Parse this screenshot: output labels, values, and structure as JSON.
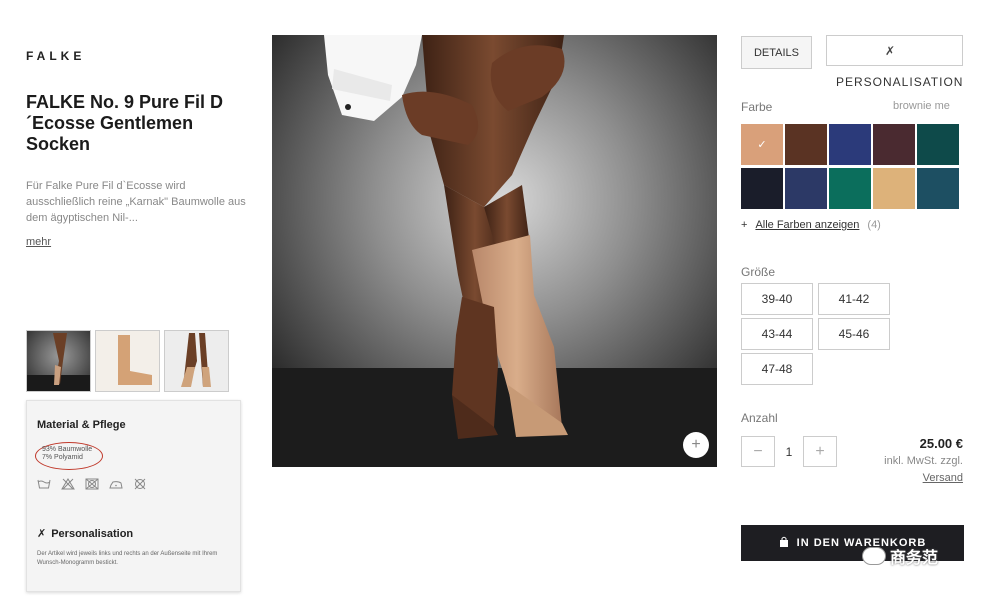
{
  "brand": "FALKE",
  "product": {
    "title": "FALKE No. 9 Pure Fil D ´Ecosse Gentlemen Socken",
    "description": "Für Falke Pure Fil d`Ecosse wird ausschließlich reine „Karnak\" Baumwolle aus dem ägyptischen Nil-...",
    "more_label": "mehr"
  },
  "care": {
    "title": "Material & Pflege",
    "material_lines": [
      "93% Baumwolle",
      "7% Polyamid"
    ],
    "icons": [
      "wash-30-icon",
      "no-bleach-icon",
      "no-tumble-dry-icon",
      "iron-icon",
      "no-dry-clean-icon"
    ],
    "personalisation_title": "Personalisation",
    "personalisation_text": "Der Artikel wird jeweils links und rechts an der Außenseite mit Ihrem Wunsch-Monogramm bestickt."
  },
  "tabs": {
    "details": "DETAILS",
    "personalisation": "PERSONALISATION",
    "personalisation_icon": "needle-icon"
  },
  "colors": {
    "label": "Farbe",
    "selected": "brownie me",
    "swatches": [
      "#d9a07a",
      "#5a3323",
      "#2b3a7a",
      "#4a2a30",
      "#0e4a4a",
      "#1a1d2a",
      "#2c3966",
      "#0b6e5c",
      "#ddb27a",
      "#1d4f62"
    ],
    "all_label": "Alle Farben anzeigen",
    "all_count": "(4)"
  },
  "sizes": {
    "label": "Größe",
    "options": [
      "39-40",
      "41-42",
      "43-44",
      "45-46",
      "47-48"
    ]
  },
  "quantity": {
    "label": "Anzahl",
    "value": "1",
    "minus": "−",
    "plus": "+"
  },
  "price": {
    "value": "25.00 €",
    "vat": "inkl. MwSt. zzgl.",
    "shipping": "Versand"
  },
  "cart_button": "IN DEN WARENKORB",
  "watermark": "商务范"
}
